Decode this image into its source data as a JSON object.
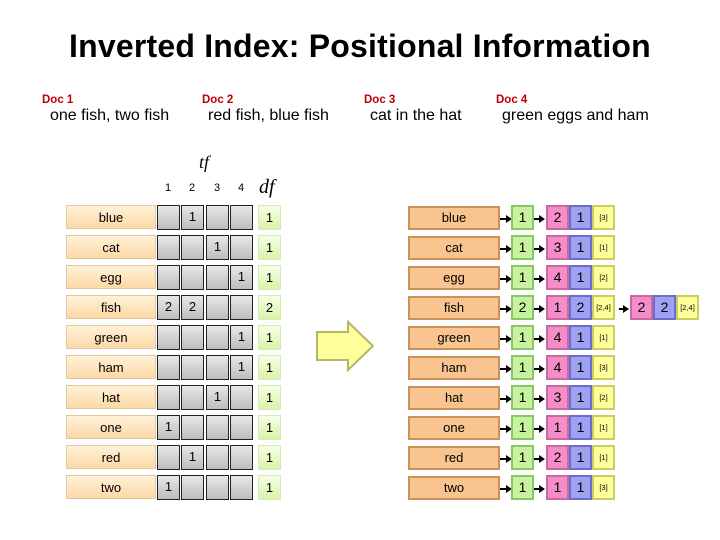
{
  "title": "Inverted Index: Positional Information",
  "documents": [
    {
      "label": "Doc 1",
      "text": "one fish, two fish"
    },
    {
      "label": "Doc 2",
      "text": "red fish, blue fish"
    },
    {
      "label": "Doc 3",
      "text": "cat in the hat"
    },
    {
      "label": "Doc 4",
      "text": "green eggs and ham"
    }
  ],
  "matrix": {
    "tf_label": "tf",
    "df_label": "df",
    "columns": [
      "1",
      "2",
      "3",
      "4"
    ],
    "rows": [
      {
        "term": "blue",
        "tf": [
          "",
          "1",
          "",
          ""
        ],
        "df": "1"
      },
      {
        "term": "cat",
        "tf": [
          "",
          "",
          "1",
          ""
        ],
        "df": "1"
      },
      {
        "term": "egg",
        "tf": [
          "",
          "",
          "",
          "1"
        ],
        "df": "1"
      },
      {
        "term": "fish",
        "tf": [
          "2",
          "2",
          "",
          ""
        ],
        "df": "2"
      },
      {
        "term": "green",
        "tf": [
          "",
          "",
          "",
          "1"
        ],
        "df": "1"
      },
      {
        "term": "ham",
        "tf": [
          "",
          "",
          "",
          "1"
        ],
        "df": "1"
      },
      {
        "term": "hat",
        "tf": [
          "",
          "",
          "1",
          ""
        ],
        "df": "1"
      },
      {
        "term": "one",
        "tf": [
          "1",
          "",
          "",
          ""
        ],
        "df": "1"
      },
      {
        "term": "red",
        "tf": [
          "",
          "1",
          "",
          ""
        ],
        "df": "1"
      },
      {
        "term": "two",
        "tf": [
          "1",
          "",
          "",
          ""
        ],
        "df": "1"
      }
    ]
  },
  "transform_arrow_icon": "block-arrow-right",
  "postings": [
    {
      "term": "blue",
      "df": "1",
      "postings": [
        {
          "doc": "2",
          "tf": "1",
          "positions": "[3]"
        }
      ]
    },
    {
      "term": "cat",
      "df": "1",
      "postings": [
        {
          "doc": "3",
          "tf": "1",
          "positions": "[1]"
        }
      ]
    },
    {
      "term": "egg",
      "df": "1",
      "postings": [
        {
          "doc": "4",
          "tf": "1",
          "positions": "[2]"
        }
      ]
    },
    {
      "term": "fish",
      "df": "2",
      "postings": [
        {
          "doc": "1",
          "tf": "2",
          "positions": "[2,4]"
        },
        {
          "doc": "2",
          "tf": "2",
          "positions": "[2,4]"
        }
      ]
    },
    {
      "term": "green",
      "df": "1",
      "postings": [
        {
          "doc": "4",
          "tf": "1",
          "positions": "[1]"
        }
      ]
    },
    {
      "term": "ham",
      "df": "1",
      "postings": [
        {
          "doc": "4",
          "tf": "1",
          "positions": "[3]"
        }
      ]
    },
    {
      "term": "hat",
      "df": "1",
      "postings": [
        {
          "doc": "3",
          "tf": "1",
          "positions": "[2]"
        }
      ]
    },
    {
      "term": "one",
      "df": "1",
      "postings": [
        {
          "doc": "1",
          "tf": "1",
          "positions": "[1]"
        }
      ]
    },
    {
      "term": "red",
      "df": "1",
      "postings": [
        {
          "doc": "2",
          "tf": "1",
          "positions": "[1]"
        }
      ]
    },
    {
      "term": "two",
      "df": "1",
      "postings": [
        {
          "doc": "1",
          "tf": "1",
          "positions": "[3]"
        }
      ]
    }
  ]
}
